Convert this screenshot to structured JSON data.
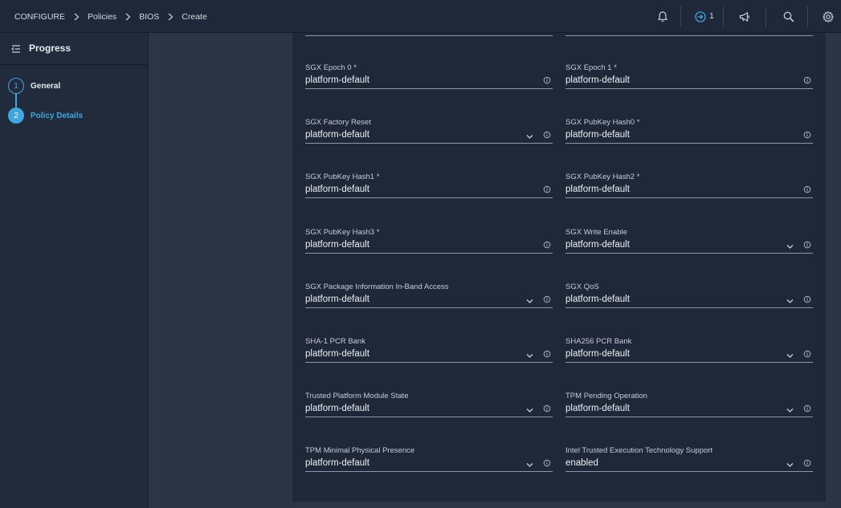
{
  "breadcrumb": [
    "CONFIGURE",
    "Policies",
    "BIOS",
    "Create"
  ],
  "topbar": {
    "icons": [
      "bell-icon",
      "sign-in-icon",
      "megaphone-icon",
      "search-icon",
      "gear-icon"
    ],
    "signin_count": "1"
  },
  "sidebar": {
    "title": "Progress",
    "steps": [
      {
        "number": "1",
        "label": "General",
        "state": "done"
      },
      {
        "number": "2",
        "label": "Policy Details",
        "state": "active"
      }
    ]
  },
  "colors": {
    "accent": "#3fa7e0",
    "background": "#2b3546",
    "panel": "#1f2838"
  },
  "fields": [
    {
      "label": "SGX Epoch 0 *",
      "value": "platform-default",
      "dropdown": false
    },
    {
      "label": "SGX Epoch 1 *",
      "value": "platform-default",
      "dropdown": false
    },
    {
      "label": "SGX Factory Reset",
      "value": "platform-default",
      "dropdown": true
    },
    {
      "label": "SGX PubKey Hash0 *",
      "value": "platform-default",
      "dropdown": false
    },
    {
      "label": "SGX PubKey Hash1 *",
      "value": "platform-default",
      "dropdown": false
    },
    {
      "label": "SGX PubKey Hash2 *",
      "value": "platform-default",
      "dropdown": false
    },
    {
      "label": "SGX PubKey Hash3 *",
      "value": "platform-default",
      "dropdown": false
    },
    {
      "label": "SGX Write Enable",
      "value": "platform-default",
      "dropdown": true
    },
    {
      "label": "SGX Package Information In-Band Access",
      "value": "platform-default",
      "dropdown": true
    },
    {
      "label": "SGX QoS",
      "value": "platform-default",
      "dropdown": true
    },
    {
      "label": "SHA-1 PCR Bank",
      "value": "platform-default",
      "dropdown": true
    },
    {
      "label": "SHA256 PCR Bank",
      "value": "platform-default",
      "dropdown": true
    },
    {
      "label": "Trusted Platform Module State",
      "value": "platform-default",
      "dropdown": true
    },
    {
      "label": "TPM Pending Operation",
      "value": "platform-default",
      "dropdown": true
    },
    {
      "label": "TPM Minimal Physical Presence",
      "value": "platform-default",
      "dropdown": true
    },
    {
      "label": "Intel Trusted Execution Technology Support",
      "value": "enabled",
      "dropdown": true
    }
  ]
}
